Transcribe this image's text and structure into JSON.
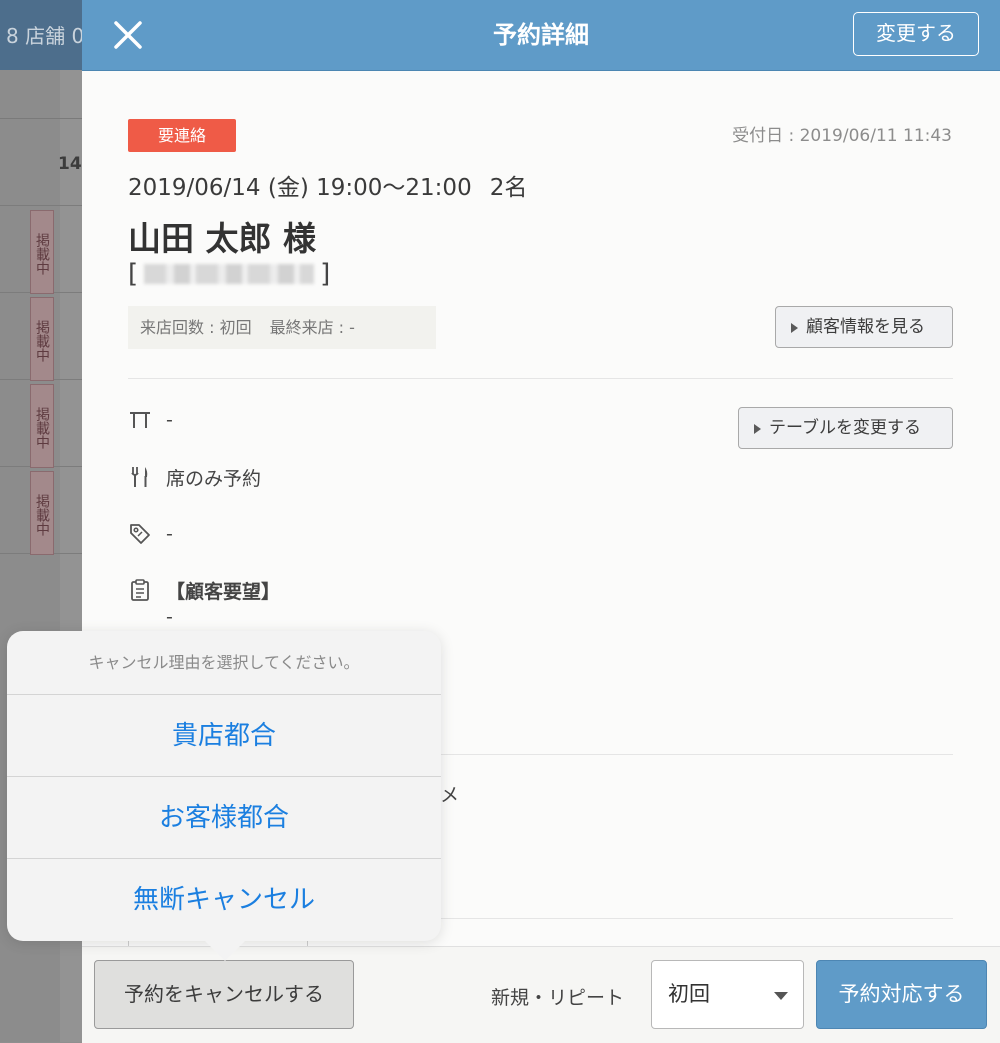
{
  "background": {
    "title": "8 店舗 0",
    "time_label": "14:",
    "badge_text": "掲載中"
  },
  "header": {
    "title": "予約詳細",
    "change_button": "変更する",
    "close_icon": "close-icon"
  },
  "reservation": {
    "status_tag": "要連絡",
    "received": "受付日 : 2019/06/11 11:43",
    "datetime": "2019/06/14 (金) 19:00〜21:00",
    "people": "2名",
    "guest_name": "山田 太郎 様",
    "phone_open": "[",
    "phone_close": "]",
    "visit_count": "来店回数 : 初回",
    "last_visit": "最終来店 : -",
    "customer_info_button": "顧客情報を見る",
    "table_value": "-",
    "change_table_button": "テーブルを変更する",
    "course": "席のみ予約",
    "tag_value": "-",
    "request_title": "【顧客要望】",
    "request_value": "-",
    "memo_partial": "メ"
  },
  "footer": {
    "cancel_button": "予約をキャンセルする",
    "new_repeat_label": "新規・リピート",
    "visit_select_value": "初回",
    "respond_button": "予約対応する"
  },
  "popover": {
    "title": "キャンセル理由を選択してください。",
    "options": [
      "貴店都合",
      "お客様都合",
      "無断キャンセル"
    ]
  },
  "colors": {
    "header_blue": "#5f9bc8",
    "tag_red": "#ef5b47",
    "option_blue": "#1b7fe0"
  }
}
